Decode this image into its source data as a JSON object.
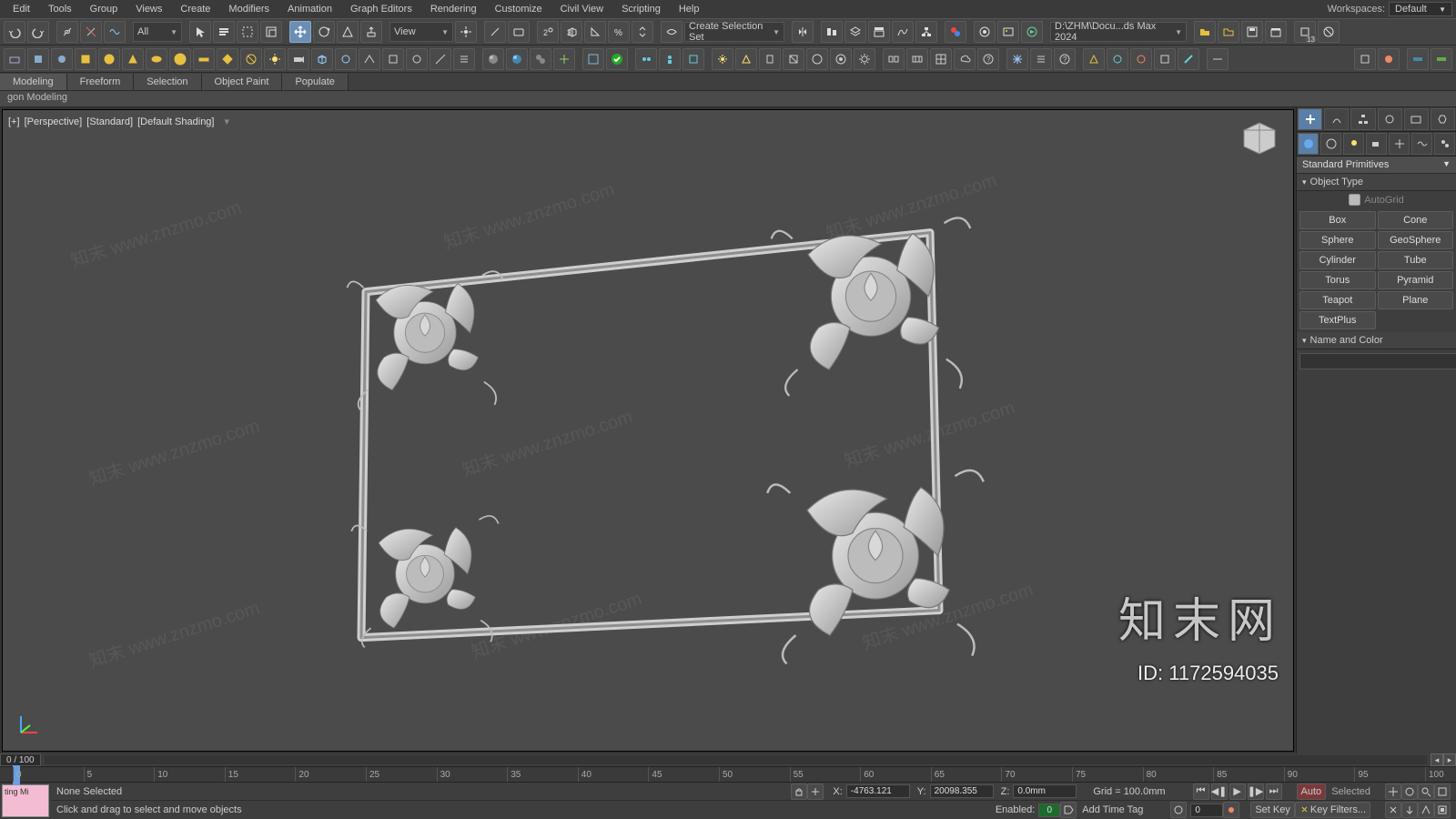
{
  "menubar": {
    "items": [
      "Edit",
      "Tools",
      "Group",
      "Views",
      "Create",
      "Modifiers",
      "Animation",
      "Graph Editors",
      "Rendering",
      "Customize",
      "Civil View",
      "Scripting",
      "Help"
    ],
    "workspaces_label": "Workspaces:",
    "workspace_value": "Default"
  },
  "toolbar1": {
    "all_dd": "All",
    "view_dd": "View",
    "selset_dd": "Create Selection Set",
    "path_dd": "D:\\ZHM\\Docu...ds Max 2024",
    "isolate_badge": "13"
  },
  "ribbon": {
    "tabs": [
      "Modeling",
      "Freeform",
      "Selection",
      "Object Paint",
      "Populate"
    ],
    "sub": "gon Modeling"
  },
  "viewport": {
    "label_parts": [
      "[+]",
      "[Perspective]",
      "[Standard]",
      "[Default Shading]"
    ],
    "watermark_text": "知末 www.znzmo.com",
    "brand": "知末网",
    "id_label": "ID: 1172594035"
  },
  "cmd": {
    "primitives_title": "Standard Primitives",
    "rollout_obj": "Object Type",
    "autogrid_label": "AutoGrid",
    "buttons": [
      "Box",
      "Cone",
      "Sphere",
      "GeoSphere",
      "Cylinder",
      "Tube",
      "Torus",
      "Pyramid",
      "Teapot",
      "Plane",
      "TextPlus",
      ""
    ],
    "rollout_name": "Name and Color",
    "color_swatch": "#e83fae"
  },
  "slider": {
    "frame": "0 / 100"
  },
  "timeline": {
    "ticks": [
      0,
      5,
      10,
      15,
      20,
      25,
      30,
      35,
      40,
      45,
      50,
      55,
      60,
      65,
      70,
      75,
      80,
      85,
      90,
      95,
      100
    ]
  },
  "status": {
    "mini": "ting Mi",
    "sel": "None Selected",
    "hint": "Click and drag to select and move objects",
    "enabled_label": "Enabled:",
    "enabled_val": "0",
    "addtag": "Add Time Tag",
    "x_label": "X:",
    "x_val": "-4763.121",
    "y_label": "Y:",
    "y_val": "20098.355",
    "z_label": "Z:",
    "z_val": "0.0mm",
    "grid": "Grid = 100.0mm",
    "time_val": "0",
    "setkey": "Set Key",
    "keyfilters": "Key Filters...",
    "selected_lbl": "Selected"
  }
}
